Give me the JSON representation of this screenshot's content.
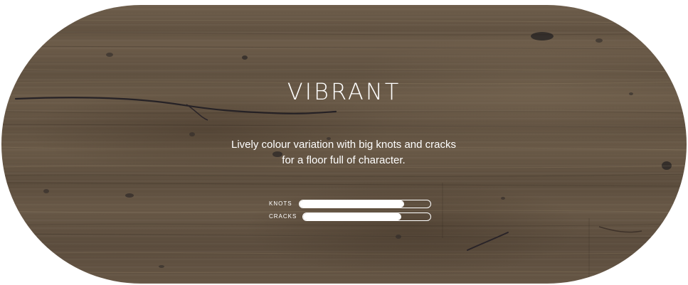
{
  "product": {
    "title": "VIBRANT",
    "description_line1": "Lively colour variation with big knots and cracks",
    "description_line2": "for a floor full of character."
  },
  "meters": [
    {
      "label": "KNOTS",
      "level": 0.8
    },
    {
      "label": "CRACKS",
      "level": 0.77
    }
  ],
  "colors": {
    "text": "#ffffff",
    "wood_base": "#6a5a48",
    "knot": "#2f2a28"
  }
}
